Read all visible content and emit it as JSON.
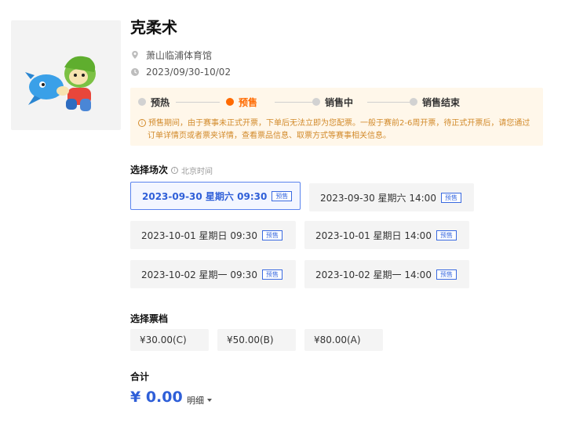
{
  "event": {
    "title": "克柔术",
    "venue": "萧山临浦体育馆",
    "date_range": "2023/09/30-10/02"
  },
  "status": {
    "steps": [
      {
        "label": "预热",
        "active": false
      },
      {
        "label": "预售",
        "active": true
      },
      {
        "label": "销售中",
        "active": false
      },
      {
        "label": "销售结束",
        "active": false
      }
    ],
    "notice_line1": "预售期间，由于赛事未正式开票，下单后无法立即为您配票。一般于赛前2-6周开票，待正式开票后，请您通过",
    "notice_line2": "订单详情页或者票夹详情，查看票品信息、取票方式等赛事相关信息。"
  },
  "sessions": {
    "label": "选择场次",
    "timezone": "北京时间",
    "items": [
      {
        "text": "2023-09-30 星期六 09:30",
        "tag": "预售",
        "selected": true
      },
      {
        "text": "2023-09-30 星期六 14:00",
        "tag": "预售",
        "selected": false
      },
      {
        "text": "2023-10-01 星期日 09:30",
        "tag": "预售",
        "selected": false
      },
      {
        "text": "2023-10-01 星期日 14:00",
        "tag": "预售",
        "selected": false
      },
      {
        "text": "2023-10-02 星期一 09:30",
        "tag": "预售",
        "selected": false
      },
      {
        "text": "2023-10-02 星期一 14:00",
        "tag": "预售",
        "selected": false
      }
    ]
  },
  "tiers": {
    "label": "选择票档",
    "items": [
      "¥30.00(C)",
      "¥50.00(B)",
      "¥80.00(A)"
    ]
  },
  "total": {
    "label": "合计",
    "amount": "¥ 0.00",
    "detail": "明细"
  },
  "icons": [
    "location-pin-icon",
    "clock-icon",
    "info-icon",
    "caret-down-icon"
  ],
  "colors": {
    "accent_blue": "#2f5fd8",
    "active_orange": "#ff6a00",
    "notice_bg": "#fff7ea",
    "notice_text": "#d28a2a"
  }
}
